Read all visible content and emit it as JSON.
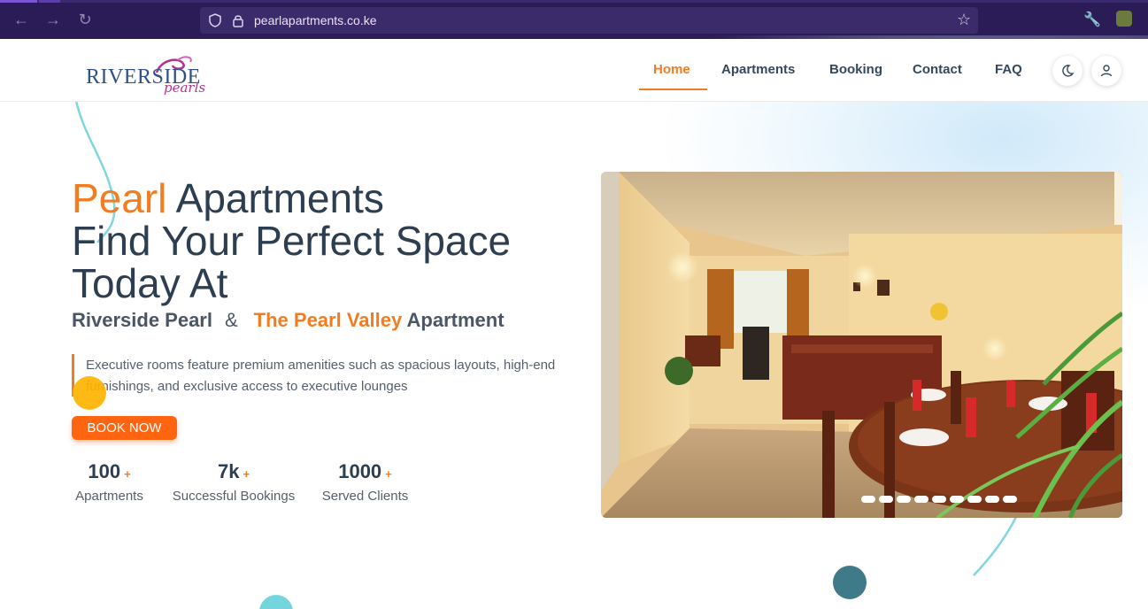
{
  "browser": {
    "url": "pearlapartments.co.ke"
  },
  "logo": {
    "main": "RIVERSIDE",
    "sub": "pearls"
  },
  "nav": {
    "items": [
      "Home",
      "Apartments",
      "Booking",
      "Contact",
      "FAQ"
    ],
    "active": "Home"
  },
  "hero": {
    "title_accent": "Pearl",
    "title_line1_rest": " Apartments",
    "title_line2": "Find Your Perfect Space",
    "title_line3": "Today At",
    "sub_part1": "Riverside Pearl",
    "sub_amp": "&",
    "sub_accent": "The Pearl Valley",
    "sub_part3": "Apartment",
    "description": "Executive rooms feature premium amenities such as spacious layouts, high-end furnishings, and exclusive access to executive lounges",
    "cta": "BOOK NOW"
  },
  "stats": [
    {
      "value": "100",
      "plus": "+",
      "label": "Apartments"
    },
    {
      "value": "7k",
      "plus": "+",
      "label": "Successful Bookings"
    },
    {
      "value": "1000",
      "plus": "+",
      "label": "Served Clients"
    }
  ],
  "slider": {
    "slide_count": 9,
    "active_slide": 1
  },
  "colors": {
    "accent": "#f47c20",
    "button": "#ff6410",
    "text_dark": "#2c3e50",
    "browser_chrome": "#2b1b56"
  }
}
